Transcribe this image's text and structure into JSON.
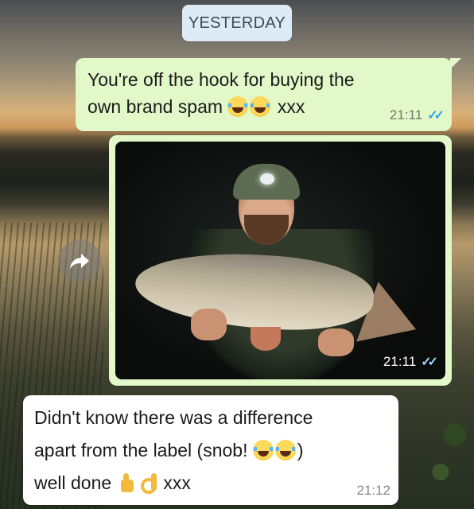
{
  "date_separator": "YESTERDAY",
  "messages": [
    {
      "direction": "outgoing",
      "type": "text",
      "text_line1": "You're off the hook for buying the",
      "text_line2_pre": "own brand spam",
      "emojis": [
        "face-with-tears-of-joy",
        "face-with-tears-of-joy"
      ],
      "text_line2_post": "xxx",
      "time": "21:11",
      "status": "read"
    },
    {
      "direction": "outgoing",
      "type": "image",
      "image_subject": "angler holding a barbel fish at night",
      "time": "21:11",
      "status": "read"
    },
    {
      "direction": "incoming",
      "type": "text",
      "line1": "Didn't know there was a difference",
      "line2_pre": "apart from the label (snob!",
      "line2_post": ")",
      "line3_pre": "well done",
      "line3_post": "xxx",
      "emojis": [
        "face-with-tears-of-joy",
        "face-with-tears-of-joy",
        "thumbs-up",
        "ok-hand"
      ],
      "time": "21:12"
    }
  ],
  "icons": {
    "forward": "forward-icon",
    "read_receipt": "double-check-icon"
  },
  "colors": {
    "outgoing_bubble": "#e2f8c9",
    "incoming_bubble": "#ffffff",
    "date_chip": "#dcebf5",
    "read_tick": "#34a4e8"
  }
}
